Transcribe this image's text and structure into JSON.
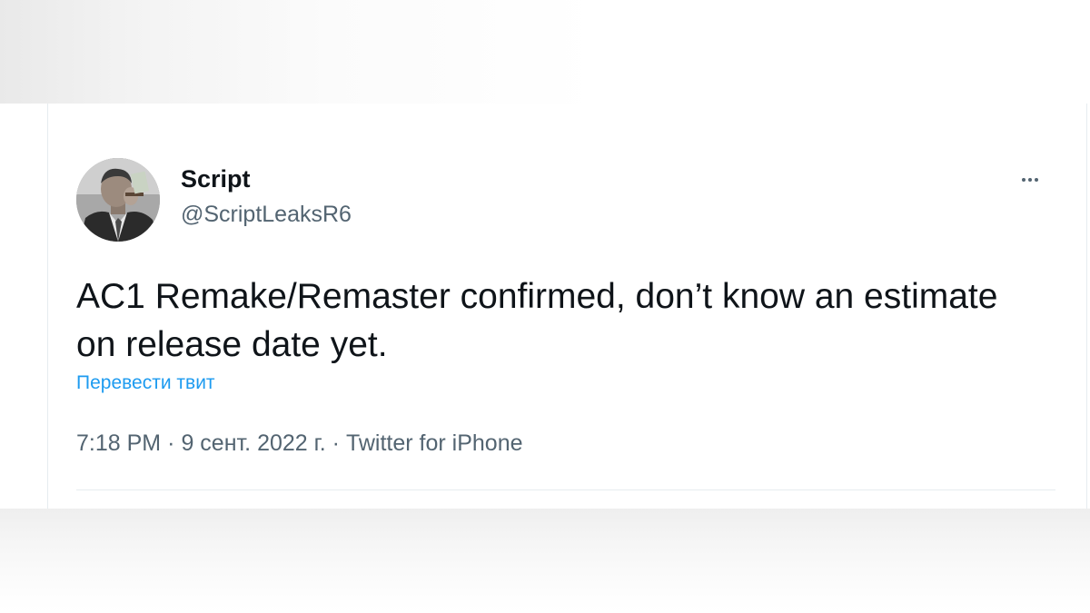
{
  "author": {
    "display_name": "Script",
    "handle": "@ScriptLeaksR6"
  },
  "tweet": {
    "text": "AC1 Remake/Remaster confirmed, don’t know an estimate on release date yet.",
    "translate_label": "Перевести твит",
    "time": "7:18 PM",
    "date": "9 сент. 2022 г.",
    "source": "Twitter for iPhone",
    "separator": "·"
  },
  "icons": {
    "more": "more-horizontal-icon",
    "avatar": "avatar-image"
  },
  "colors": {
    "text_primary": "#0f1419",
    "text_secondary": "#536471",
    "link": "#1d9bf0",
    "divider": "#e6ecf0"
  }
}
